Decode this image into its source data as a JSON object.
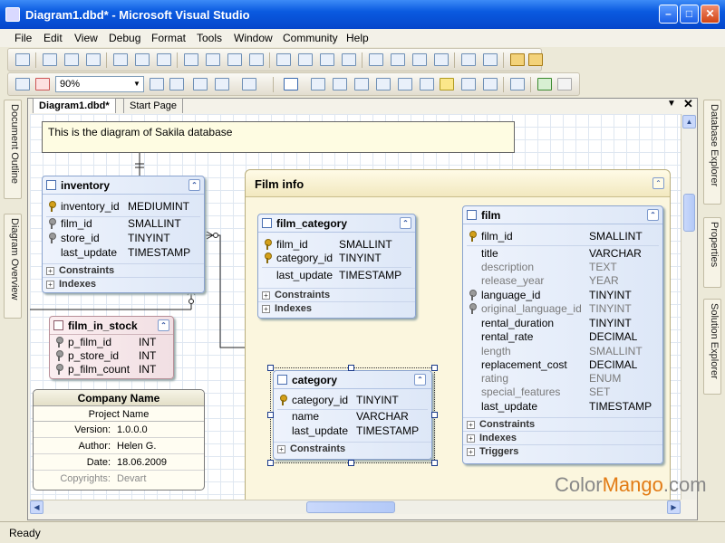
{
  "window": {
    "title": "Diagram1.dbd* - Microsoft Visual Studio"
  },
  "menu": [
    "File",
    "Edit",
    "View",
    "Debug",
    "Format",
    "Tools",
    "Window",
    "Community",
    "Help"
  ],
  "zoom": "90%",
  "tabs": {
    "diagram": "Diagram1.dbd*",
    "start": "Start Page"
  },
  "left_panels": [
    "Document Outline",
    "Diagram Overview"
  ],
  "right_panels": [
    "Database Explorer",
    "Properties",
    "Solution Explorer"
  ],
  "note": "This is the diagram of Sakila database",
  "film_info_title": "Film info",
  "inventory": {
    "name": "inventory",
    "rows": [
      {
        "n": "inventory_id",
        "t": "MEDIUMINT"
      },
      {
        "n": "film_id",
        "t": "SMALLINT"
      },
      {
        "n": "store_id",
        "t": "TINYINT"
      },
      {
        "n": "last_update",
        "t": "TIMESTAMP"
      }
    ],
    "sections": [
      "Constraints",
      "Indexes"
    ]
  },
  "film_in_stock": {
    "name": "film_in_stock",
    "rows": [
      {
        "n": "p_film_id",
        "t": "INT"
      },
      {
        "n": "p_store_id",
        "t": "INT"
      },
      {
        "n": "p_film_count",
        "t": "INT"
      }
    ]
  },
  "film_category": {
    "name": "film_category",
    "rows": [
      {
        "n": "film_id",
        "t": "SMALLINT"
      },
      {
        "n": "category_id",
        "t": "TINYINT"
      },
      {
        "n": "last_update",
        "t": "TIMESTAMP"
      }
    ],
    "sections": [
      "Constraints",
      "Indexes"
    ]
  },
  "category": {
    "name": "category",
    "rows": [
      {
        "n": "category_id",
        "t": "TINYINT"
      },
      {
        "n": "name",
        "t": "VARCHAR"
      },
      {
        "n": "last_update",
        "t": "TIMESTAMP"
      }
    ],
    "sections": [
      "Constraints"
    ]
  },
  "film": {
    "name": "film",
    "rows": [
      {
        "n": "film_id",
        "t": "SMALLINT"
      },
      {
        "n": "title",
        "t": "VARCHAR"
      },
      {
        "n": "description",
        "t": "TEXT"
      },
      {
        "n": "release_year",
        "t": "YEAR"
      },
      {
        "n": "language_id",
        "t": "TINYINT"
      },
      {
        "n": "original_language_id",
        "t": "TINYINT"
      },
      {
        "n": "rental_duration",
        "t": "TINYINT"
      },
      {
        "n": "rental_rate",
        "t": "DECIMAL"
      },
      {
        "n": "length",
        "t": "SMALLINT"
      },
      {
        "n": "replacement_cost",
        "t": "DECIMAL"
      },
      {
        "n": "rating",
        "t": "ENUM"
      },
      {
        "n": "special_features",
        "t": "SET"
      },
      {
        "n": "last_update",
        "t": "TIMESTAMP"
      }
    ],
    "sections": [
      "Constraints",
      "Indexes",
      "Triggers"
    ]
  },
  "company": {
    "name": "Company Name",
    "project": "Project Name",
    "rows": [
      {
        "k": "Version:",
        "v": "1.0.0.0"
      },
      {
        "k": "Author:",
        "v": "Helen G."
      },
      {
        "k": "Date:",
        "v": "18.06.2009"
      },
      {
        "k": "Copyrights:",
        "v": "Devart"
      }
    ]
  },
  "watermark": {
    "a": "Color",
    "b": "Mango",
    ".com": ".com"
  },
  "status": "Ready"
}
